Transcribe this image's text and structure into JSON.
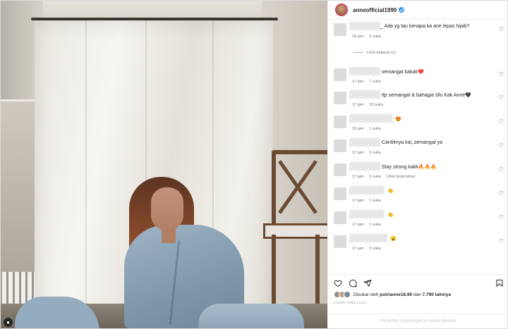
{
  "post": {
    "username": "anneofficial1990",
    "verified": true
  },
  "comments": [
    {
      "text": "_ Ada yg tau kenapa ka ane lepas hijab?",
      "time": "18 jam",
      "likes": "5 suka",
      "extra": "",
      "replies": "Lihat balasan (1)"
    },
    {
      "text": "semangat kakak❤️",
      "time": "17 jam",
      "likes": "7 suka",
      "extra": ""
    },
    {
      "text": "ttp semangat & bahagia sllu Kak Anne🖤",
      "time": "17 jam",
      "likes": "32 suka",
      "extra": ""
    },
    {
      "text": "😍",
      "time": "18 jam",
      "likes": "1 suka",
      "extra": ""
    },
    {
      "text": "Cantiknya kal,,semangat ya",
      "time": "17 jam",
      "likes": "6 suka",
      "extra": ""
    },
    {
      "text": "Stay strong kakk🔥🔥🔥",
      "time": "17 jam",
      "likes": "6 suka",
      "extra": "Lihat terjemahan"
    },
    {
      "text": "👏",
      "time": "17 jam",
      "likes": "1 suka",
      "extra": ""
    },
    {
      "text": "👏",
      "time": "17 jam",
      "likes": "1 suka",
      "extra": ""
    },
    {
      "text": "😮",
      "time": "17 jam",
      "likes": "2 suka",
      "extra": ""
    }
  ],
  "actions": {
    "like_icon": "heart-outline-icon",
    "comment_icon": "comment-icon",
    "share_icon": "paper-plane-icon",
    "save_icon": "bookmark-icon"
  },
  "likes_line": {
    "prefix": "Disukai oleh",
    "user": "putrianne18.90",
    "middle": "dan",
    "others": "7.790 lainnya"
  },
  "timestamp": "1 HARI YANG LALU",
  "comments_closed": "Komentar di postingan ini sudah dibatasi",
  "colors": {
    "verified": "#3897f0",
    "text": "#262626",
    "meta": "#737373"
  }
}
